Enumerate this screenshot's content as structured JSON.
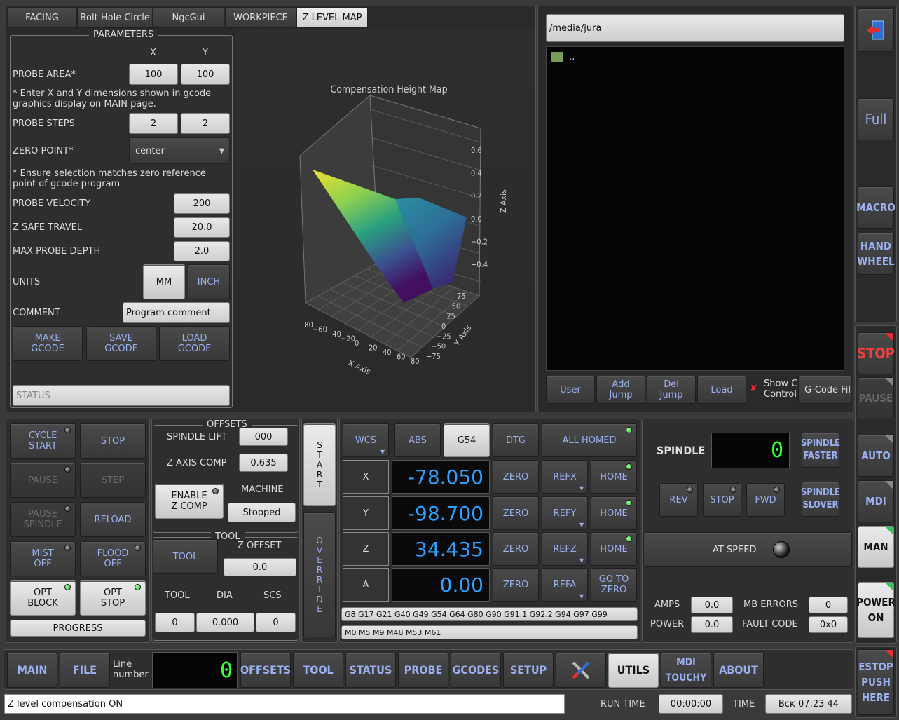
{
  "tabs": [
    "FACING",
    "Bolt Hole Circle",
    "NgcGui",
    "WORKPIECE",
    "Z LEVEL MAP"
  ],
  "params": {
    "title": "PARAMETERS",
    "x": "X",
    "y": "Y",
    "probe_area": "PROBE AREA*",
    "pa_x": "100",
    "pa_y": "100",
    "note1a": "* Enter X and Y dimensions shown in gcode",
    "note1b": "graphics display on MAIN page.",
    "probe_steps": "PROBE STEPS",
    "ps_x": "2",
    "ps_y": "2",
    "zero_point": "ZERO POINT*",
    "zero_val": "center",
    "note2a": "* Ensure selection matches zero reference",
    "note2b": "point of gcode program",
    "probe_velocity": "PROBE VELOCITY",
    "pv": "200",
    "z_safe": "Z SAFE TRAVEL",
    "zs": "20.0",
    "max_depth": "MAX PROBE DEPTH",
    "md": "2.0",
    "units": "UNITS",
    "mm": "MM",
    "inch": "INCH",
    "comment": "COMMENT",
    "comment_val": "Program comment",
    "make": "MAKE\nGCODE",
    "save": "SAVE\nGCODE",
    "load": "LOAD\nGCODE",
    "status": "STATUS"
  },
  "chart_data": {
    "type": "surface3d",
    "title": "Compensation Height Map",
    "xlabel": "X Axis",
    "ylabel": "Y Axis",
    "zlabel": "Z Axis",
    "x_ticks": [
      "−80",
      "−60",
      "−40",
      "−20",
      "0",
      "20",
      "40",
      "60",
      "80"
    ],
    "y_ticks": [
      "−75",
      "−50",
      "−25",
      "0",
      "25",
      "50",
      "75"
    ],
    "z_ticks": [
      "0.6",
      "0.4",
      "0.2",
      "0.0",
      "−0.2",
      "−0.4"
    ],
    "xlim": [
      -80,
      80
    ],
    "ylim": [
      -75,
      75
    ],
    "zlim": [
      -0.4,
      0.6
    ],
    "grid": true,
    "colormap": "viridis"
  },
  "file": {
    "path": "/media/jura",
    "item": "..",
    "user": "User",
    "add": "Add\nJump",
    "del": "Del\nJump",
    "load": "Load",
    "show": "Show C\nControl",
    "gcode": "G-Code Fil"
  },
  "side": {
    "full": "Full",
    "macro": "MACRO",
    "hand": "HAND\nWHEEL",
    "stop": "STOP",
    "pause": "PAUSE",
    "auto": "AUTO",
    "mdi": "MDI",
    "man": "MAN",
    "power": "POWER\nON",
    "estop": "ESTOP\nPUSH\nHERE"
  },
  "cycle": {
    "start": "CYCLE\nSTART",
    "stop": "STOP",
    "pause": "PAUSE",
    "step": "STEP",
    "pspindle": "PAUSE\nSPINDLE",
    "reload": "RELOAD",
    "mist": "MIST\nOFF",
    "flood": "FLOOD\nOFF",
    "optblock": "OPT\nBLOCK",
    "optstop": "OPT\nSTOP",
    "progress": "PROGRESS"
  },
  "offsets": {
    "title": "OFFSETS",
    "spindle_lift": "SPINDLE LIFT",
    "sl": "000",
    "zcomp": "Z AXIS COMP",
    "zc": "0.635",
    "enable": "ENABLE\nZ COMP",
    "machine": "MACHINE",
    "state": "Stopped"
  },
  "tool": {
    "title": "TOOL",
    "btn": "TOOL",
    "zoff": "Z OFFSET",
    "zoff_val": "0.0",
    "tool": "TOOL",
    "dia": "DIA",
    "scs": "SCS",
    "tool_val": "0",
    "dia_val": "0.000",
    "scs_val": "0"
  },
  "start": "S\nT\nA\nR\nT",
  "override": "O\nV\nE\nR\nR\nI\nD\nE",
  "dro": {
    "wcs": "WCS",
    "abs": "ABS",
    "g54": "G54",
    "dtg": "DTG",
    "homed": "ALL HOMED",
    "x": "X",
    "y": "Y",
    "z": "Z",
    "a": "A",
    "xv": "-78.050",
    "yv": "-98.700",
    "zv": "34.435",
    "av": "0.00",
    "zero": "ZERO",
    "refx": "REFX",
    "refy": "REFY",
    "refz": "REFZ",
    "refa": "REFA",
    "home": "HOME",
    "goto": "GO TO\nZERO",
    "gcodes": "G8 G17 G21 G40 G49 G54 G64 G80 G90 G91.1 G92.2 G94 G97 G99",
    "mcodes": "M0 M5 M9 M48 M53 M61"
  },
  "spindle": {
    "title": "SPINDLE",
    "rpm": "0",
    "faster": "SPINDLE\nFASTER",
    "slower": "SPINDLE\nSLOVER",
    "rev": "REV",
    "stop": "STOP",
    "fwd": "FWD",
    "atspeed": "AT SPEED",
    "amps": "AMPS",
    "amps_v": "0.0",
    "power": "POWER",
    "power_v": "0.0",
    "mberr": "MB ERRORS",
    "mberr_v": "0",
    "fault": "FAULT CODE",
    "fault_v": "0x0"
  },
  "nav": {
    "main": "MAIN",
    "file": "FILE",
    "line": "Line\nnumber",
    "line_v": "0",
    "offsets": "OFFSETS",
    "tool": "TOOL",
    "status": "STATUS",
    "probe": "PROBE",
    "gcodes": "GCODES",
    "setup": "SETUP",
    "utils": "UTILS",
    "mdi": "MDI\nTOUCHY",
    "about": "ABOUT"
  },
  "statusbar": {
    "msg": "Z level compensation ON",
    "runtime": "RUN TIME",
    "rt": "00:00:00",
    "time": "TIME",
    "tv": "Вск 07:23 44"
  }
}
